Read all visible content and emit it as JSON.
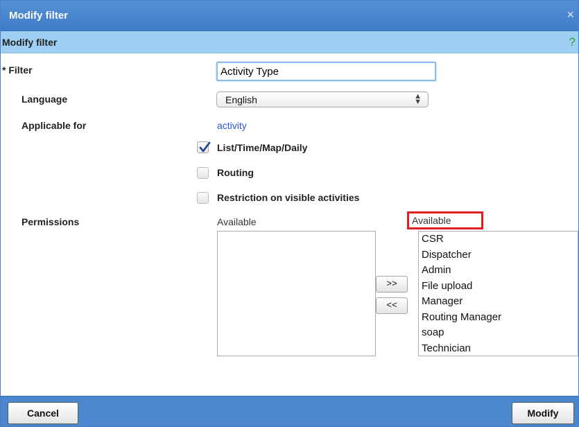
{
  "dialog": {
    "title": "Modify filter",
    "close_glyph": "×"
  },
  "subheader": {
    "title": "Modify filter",
    "help_glyph": "?"
  },
  "form": {
    "filter_label": "* Filter",
    "filter_value": "Activity Type",
    "language_label": "Language",
    "language_value": "English",
    "applicable_label": "Applicable for",
    "applicable_link": "activity",
    "options": [
      {
        "label": "List/Time/Map/Daily",
        "checked": true
      },
      {
        "label": "Routing",
        "checked": false
      },
      {
        "label": "Restriction on visible activities",
        "checked": false
      }
    ],
    "permissions_label": "Permissions"
  },
  "permissions": {
    "left_label": "Available",
    "right_label": "Available",
    "left_items": [],
    "right_items": [
      "CSR",
      "Dispatcher",
      "Admin",
      "File upload",
      "Manager",
      "Routing Manager",
      "soap",
      "Technician"
    ],
    "add_label": ">>",
    "remove_label": "<<"
  },
  "footer": {
    "cancel_label": "Cancel",
    "modify_label": "Modify"
  },
  "colors": {
    "titlebar": "#4a87d0",
    "subheader": "#9fd0f3",
    "highlight": "#e02020",
    "link": "#2b55d6",
    "help": "#2ca02c"
  },
  "icons": {
    "close": "close-icon",
    "help": "help-icon",
    "checkmark": "checkmark-icon",
    "select_arrows": "updown-arrows-icon"
  }
}
